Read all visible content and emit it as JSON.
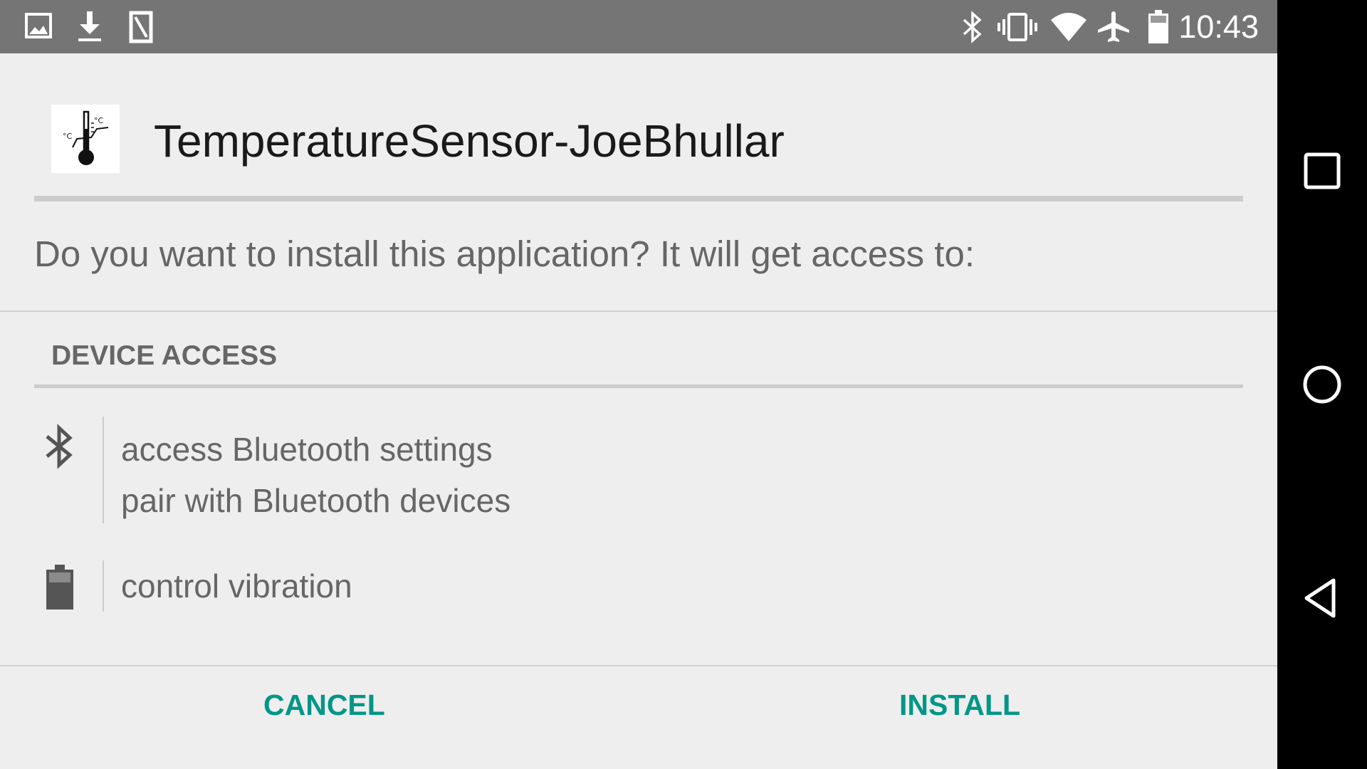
{
  "status_bar": {
    "time": "10:43",
    "left_icons": [
      "image-notification-icon",
      "download-icon",
      "sd-card-icon"
    ],
    "right_icons": [
      "bluetooth-icon",
      "vibrate-icon",
      "wifi-icon",
      "airplane-mode-icon",
      "battery-icon"
    ]
  },
  "app": {
    "name": "TemperatureSensor-JoeBhullar",
    "icon": "thermometer-icon"
  },
  "dialog": {
    "question": "Do you want to install this application? It will get access to:",
    "section_title": "DEVICE ACCESS",
    "permission_groups": [
      {
        "icon": "bluetooth-icon",
        "items": [
          "access Bluetooth settings",
          "pair with Bluetooth devices"
        ]
      },
      {
        "icon": "battery-icon",
        "items": [
          "control vibration"
        ]
      }
    ]
  },
  "buttons": {
    "cancel": "CANCEL",
    "install": "INSTALL"
  },
  "nav_bar": {
    "buttons": [
      "recents-icon",
      "home-icon",
      "back-icon"
    ]
  },
  "colors": {
    "status_bar": "#757575",
    "background": "#eeeeee",
    "accent": "#009688",
    "nav_bar": "#000000"
  }
}
